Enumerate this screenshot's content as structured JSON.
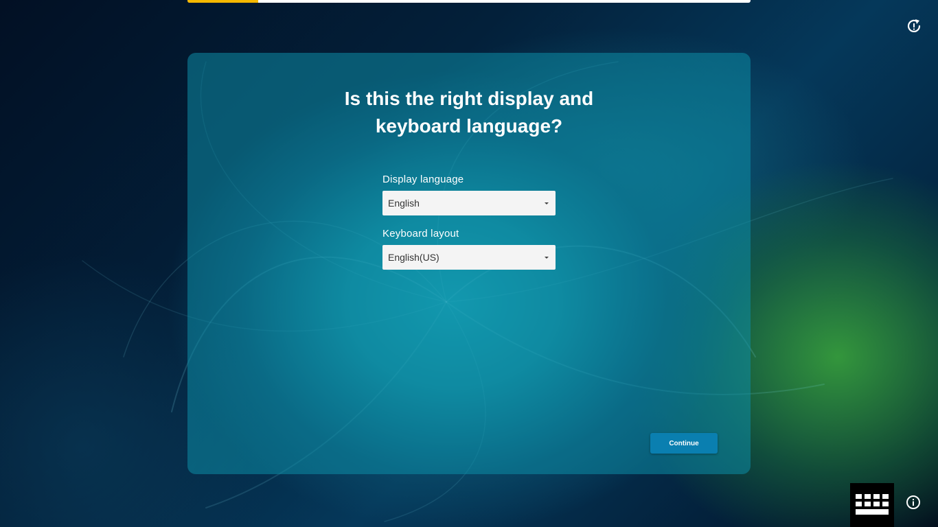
{
  "progress": {
    "fraction": 0.125,
    "track_color": "#ffffff",
    "fill_color": "#f5b800"
  },
  "card": {
    "title_line1": "Is this the right display and",
    "title_line2": "keyboard language?",
    "display_language": {
      "label": "Display language",
      "selected": "English"
    },
    "keyboard_layout": {
      "label": "Keyboard layout",
      "selected": "English(US)"
    },
    "continue_label": "Continue",
    "accent_color": "#0a7fb0"
  },
  "icons": {
    "top_right": "restart-info-icon",
    "bottom_right": "info-icon",
    "keyboard": "keyboard-icon"
  }
}
